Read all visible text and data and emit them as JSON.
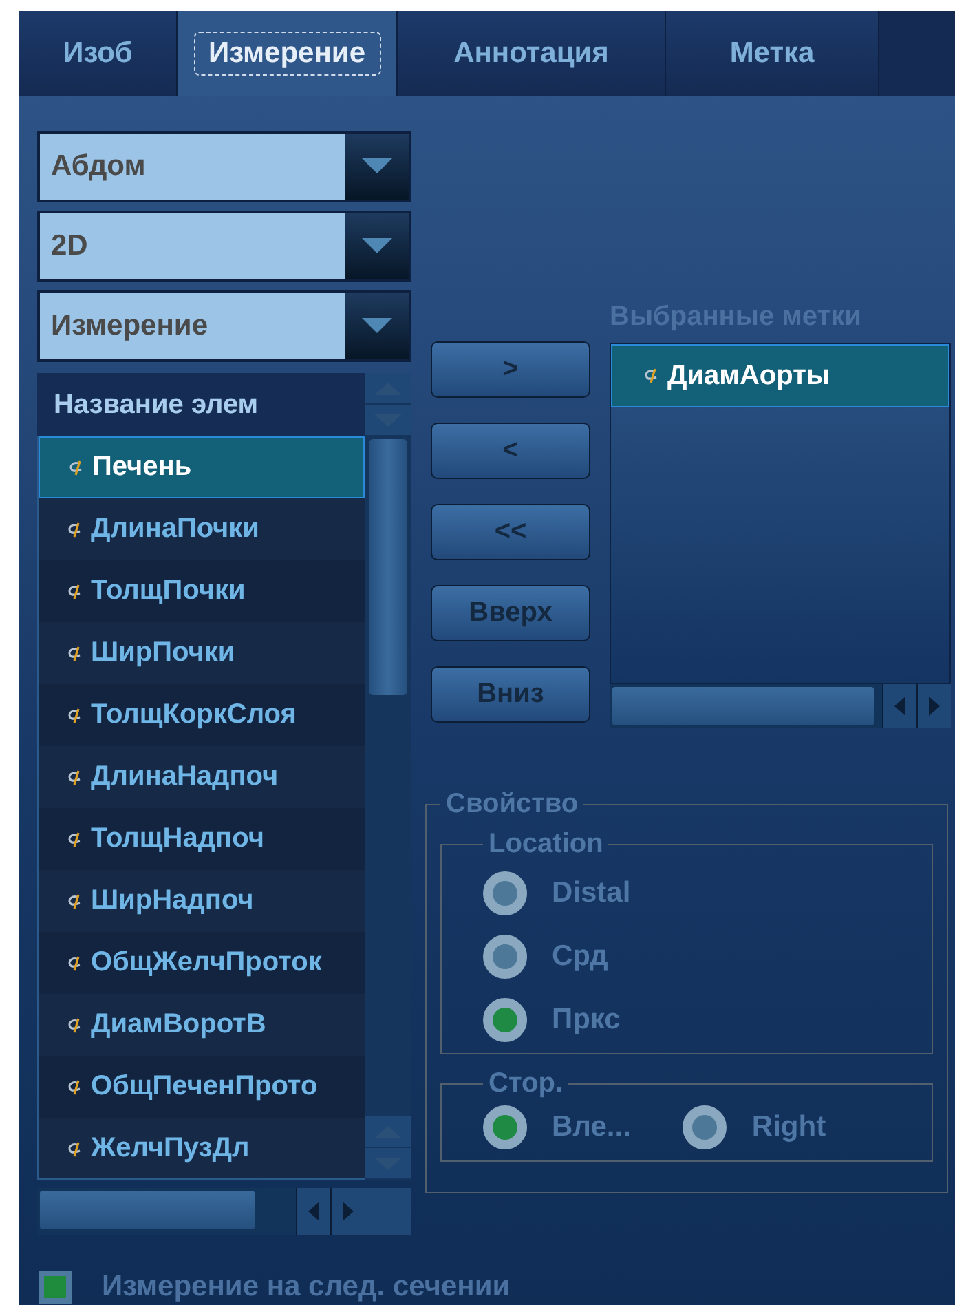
{
  "tabs": [
    {
      "label": "Изоб",
      "selected": false
    },
    {
      "label": "Измерение",
      "selected": true
    },
    {
      "label": "Аннотация",
      "selected": false
    },
    {
      "label": "Метка",
      "selected": false
    }
  ],
  "dropdowns": [
    {
      "value": "Абдом"
    },
    {
      "value": "2D"
    },
    {
      "value": "Измерение"
    }
  ],
  "item_list": {
    "header": "Название элем",
    "items": [
      {
        "label": "Печень",
        "selected": true
      },
      {
        "label": "ДлинаПочки",
        "selected": false
      },
      {
        "label": "ТолщПочки",
        "selected": false
      },
      {
        "label": "ШирПочки",
        "selected": false
      },
      {
        "label": "ТолщКоркСлоя",
        "selected": false
      },
      {
        "label": "ДлинаНадпоч",
        "selected": false
      },
      {
        "label": "ТолщНадпоч",
        "selected": false
      },
      {
        "label": "ШирНадпоч",
        "selected": false
      },
      {
        "label": "ОбщЖелчПроток",
        "selected": false
      },
      {
        "label": "ДиамВоротВ",
        "selected": false
      },
      {
        "label": "ОбщПеченПрото",
        "selected": false
      },
      {
        "label": "ЖелчПузДл",
        "selected": false
      }
    ]
  },
  "transfer_buttons": [
    ">",
    "<",
    "<<",
    "Вверх",
    "Вниз"
  ],
  "selected_marks": {
    "title": "Выбранные метки",
    "items": [
      {
        "label": "ДиамАорты",
        "selected": true
      }
    ]
  },
  "property": {
    "title": "Свойство",
    "disabled": true,
    "groups": [
      {
        "title": "Location",
        "kind": "vertical",
        "options": [
          {
            "label": "Distal",
            "selected": false
          },
          {
            "label": "Срд",
            "selected": false
          },
          {
            "label": "Пркс",
            "selected": true
          }
        ]
      },
      {
        "title": "Стор.",
        "kind": "horizontal",
        "options": [
          {
            "label": "Вле...",
            "selected": true
          },
          {
            "label": "Right",
            "selected": false
          }
        ]
      }
    ]
  },
  "next_section_checkbox": {
    "label": "Измерение на след. сечении",
    "checked": true
  }
}
